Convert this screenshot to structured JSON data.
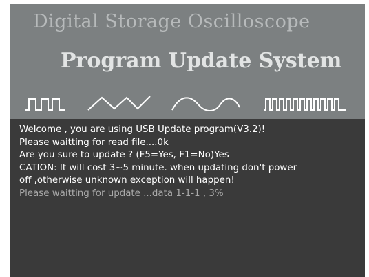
{
  "header": {
    "device_title": "Digital Storage Oscilloscope",
    "system_title": "Program Update System"
  },
  "colors": {
    "banner_bg": "#7c8081",
    "console_bg": "#3a3a3a",
    "text_primary": "#ffffff",
    "text_progress": "#a9a9a9",
    "waveform": "#ffffff"
  },
  "icons": [
    "square-wave-icon",
    "triangle-wave-icon",
    "sine-wave-icon",
    "pulse-train-icon"
  ],
  "console": {
    "lines": [
      "Welcome , you are using USB Update program(V3.2)!",
      "Please waitting for read file....0k",
      "Are you sure to update ? (F5=Yes, F1=No)Yes",
      "CATION: It will cost 3~5 minute. when updating don't power",
      "off ,otherwise unknown exception will happen!",
      "Please waitting for update ...data 1-1-1 , 3%"
    ]
  }
}
